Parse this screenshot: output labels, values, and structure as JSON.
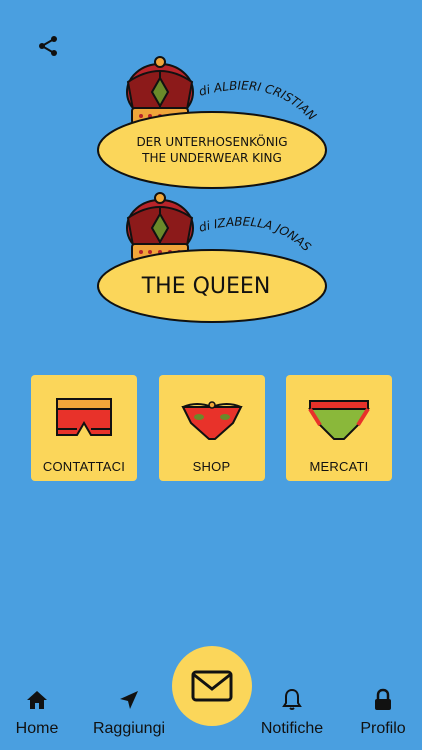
{
  "header": {
    "share_icon": "share-icon"
  },
  "logo1": {
    "author": "di ALBIERI CRISTIAN",
    "line1": "DER UNTERHOSENKÖNIG",
    "line2": "THE UNDERWEAR KING"
  },
  "logo2": {
    "author": "di IZABELLA JONAS",
    "title": "THE QUEEN"
  },
  "tiles": [
    {
      "label": "CONTATTACI",
      "icon": "boxer-briefs-icon"
    },
    {
      "label": "SHOP",
      "icon": "lace-panties-icon"
    },
    {
      "label": "MERCATI",
      "icon": "briefs-icon"
    }
  ],
  "nav": {
    "home": "Home",
    "raggiungi": "Raggiungi",
    "notifiche": "Notifiche",
    "profilo": "Profilo",
    "mail_icon": "mail-icon"
  },
  "colors": {
    "background": "#4a9fe0",
    "accent": "#fbd65a",
    "red": "#e8322a"
  }
}
